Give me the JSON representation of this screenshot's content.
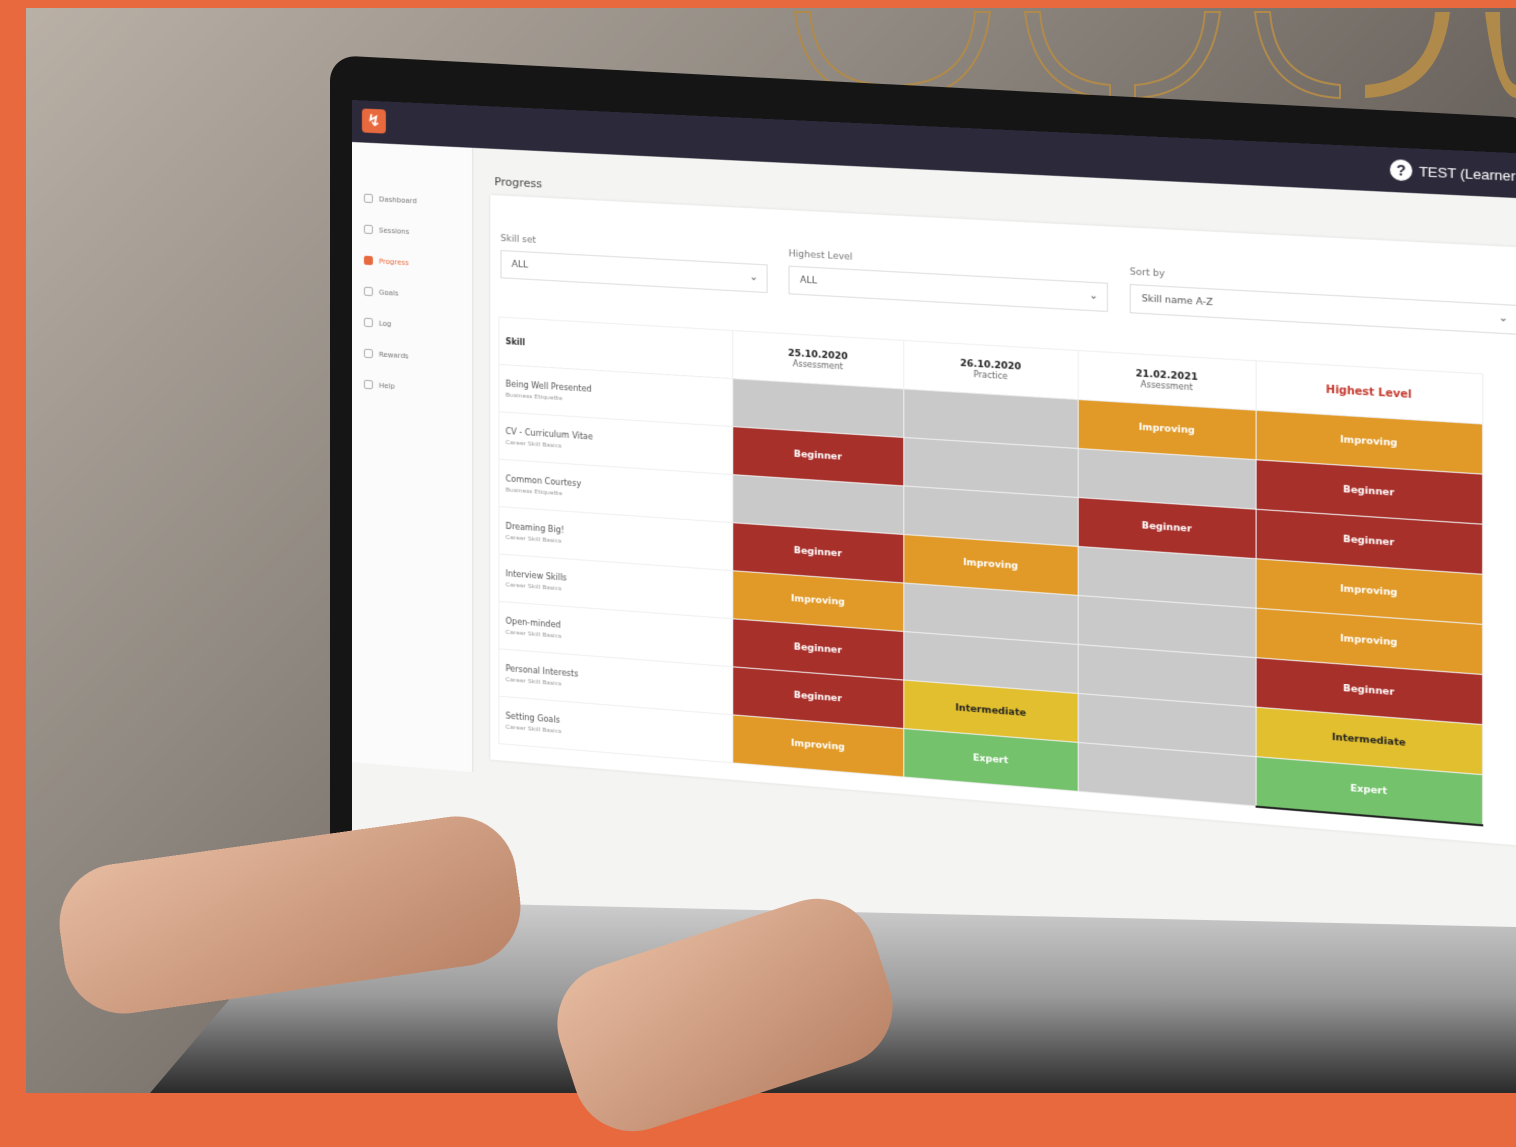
{
  "header": {
    "user_label": "TEST (Learner)",
    "help_icon": "help-icon",
    "brand_icon": "brand-logo-icon"
  },
  "sidebar": {
    "items": [
      {
        "label": "Dashboard",
        "icon": "dashboard-icon"
      },
      {
        "label": "Sessions",
        "icon": "sessions-icon"
      },
      {
        "label": "Progress",
        "icon": "progress-icon"
      },
      {
        "label": "Goals",
        "icon": "goals-icon"
      },
      {
        "label": "Log",
        "icon": "log-icon"
      },
      {
        "label": "Rewards",
        "icon": "rewards-icon"
      },
      {
        "label": "Help",
        "icon": "help-icon"
      }
    ]
  },
  "page": {
    "title": "Progress",
    "filters": {
      "skill_set_label": "Skill set",
      "skill_set_value": "ALL",
      "highest_level_label": "Highest Level",
      "highest_level_value": "ALL",
      "sort_by_label": "Sort by",
      "sort_by_value": "Skill name A-Z"
    }
  },
  "grid": {
    "skill_header": "Skill",
    "sessions": [
      {
        "date": "25.10.2020",
        "type": "Assessment"
      },
      {
        "date": "26.10.2020",
        "type": "Practice"
      },
      {
        "date": "21.02.2021",
        "type": "Assessment"
      }
    ],
    "highest_header": "Highest Level",
    "rows": [
      {
        "skill": "Being Well Presented",
        "category": "Business Etiquette",
        "levels": [
          "",
          "",
          "Improving"
        ],
        "highest": "Improving"
      },
      {
        "skill": "CV - Curriculum Vitae",
        "category": "Career Skill Basics",
        "levels": [
          "Beginner",
          "",
          ""
        ],
        "highest": "Beginner"
      },
      {
        "skill": "Common Courtesy",
        "category": "Business Etiquette",
        "levels": [
          "",
          "",
          "Beginner"
        ],
        "highest": "Beginner"
      },
      {
        "skill": "Dreaming Big!",
        "category": "Career Skill Basics",
        "levels": [
          "Beginner",
          "Improving",
          ""
        ],
        "highest": "Improving"
      },
      {
        "skill": "Interview Skills",
        "category": "Career Skill Basics",
        "levels": [
          "Improving",
          "",
          ""
        ],
        "highest": "Improving"
      },
      {
        "skill": "Open-minded",
        "category": "Career Skill Basics",
        "levels": [
          "Beginner",
          "",
          ""
        ],
        "highest": "Beginner"
      },
      {
        "skill": "Personal Interests",
        "category": "Career Skill Basics",
        "levels": [
          "Beginner",
          "Intermediate",
          ""
        ],
        "highest": "Intermediate"
      },
      {
        "skill": "Setting Goals",
        "category": "Career Skill Basics",
        "levels": [
          "Improving",
          "Expert",
          ""
        ],
        "highest": "Expert"
      }
    ]
  },
  "colors": {
    "brand_orange": "#e8693e",
    "beginner": "#a8302b",
    "improving": "#e19a28",
    "intermediate": "#e2bf2f",
    "expert": "#74c26c",
    "empty": "#c9c9c9",
    "app_bar": "#2c2a3a"
  }
}
